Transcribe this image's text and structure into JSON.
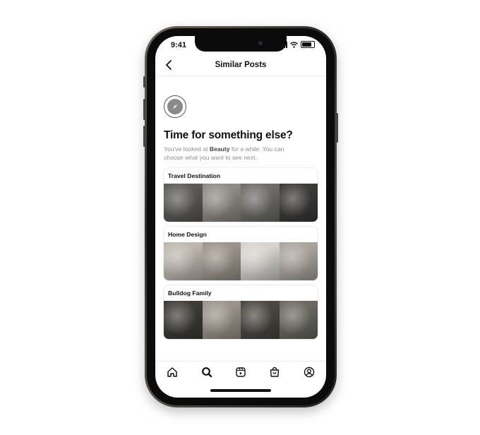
{
  "status_bar": {
    "time": "9:41"
  },
  "header": {
    "title": "Similar Posts",
    "back_icon": "chevron-left-icon"
  },
  "prompt": {
    "icon": "compass-icon",
    "headline": "Time for something else?",
    "sub_before": "You've looked at ",
    "sub_topic": "Beauty",
    "sub_after": " for a while. You can choose what you want to see next."
  },
  "topics": [
    {
      "title": "Travel Destination",
      "thumb_tones": [
        "#5c5a57",
        "#8f8b85",
        "#6e6c68",
        "#3c3a37"
      ]
    },
    {
      "title": "Home Design",
      "thumb_tones": [
        "#bdb7ae",
        "#9c948b",
        "#d6d3ce",
        "#aaa49d"
      ]
    },
    {
      "title": "Bulldog Family",
      "thumb_tones": [
        "#3e3b37",
        "#9b9389",
        "#4a4742",
        "#6b6761"
      ]
    }
  ],
  "tab_bar": [
    "home-icon",
    "search-icon",
    "reels-icon",
    "shop-icon",
    "profile-icon"
  ]
}
